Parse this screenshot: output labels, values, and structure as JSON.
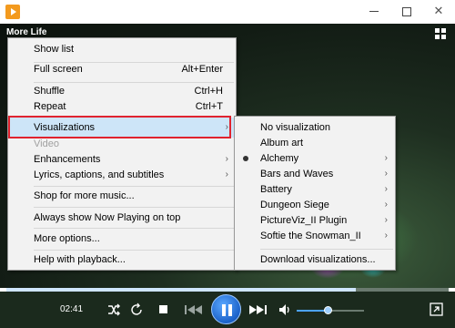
{
  "player": {
    "now_playing_title": "More Life",
    "elapsed_time": "02:41",
    "seek_progress": 0.79,
    "volume_level": 0.46
  },
  "context_menu": {
    "items": [
      {
        "label": "Show list",
        "shortcut": ""
      },
      {
        "label": "Full screen",
        "shortcut": "Alt+Enter"
      },
      {
        "label": "Shuffle",
        "shortcut": "Ctrl+H"
      },
      {
        "label": "Repeat",
        "shortcut": "Ctrl+T"
      },
      {
        "label": "Visualizations",
        "shortcut": ""
      },
      {
        "label": "Video",
        "shortcut": ""
      },
      {
        "label": "Enhancements",
        "shortcut": ""
      },
      {
        "label": "Lyrics, captions, and subtitles",
        "shortcut": ""
      },
      {
        "label": "Shop for more music...",
        "shortcut": ""
      },
      {
        "label": "Always show Now Playing on top",
        "shortcut": ""
      },
      {
        "label": "More options...",
        "shortcut": ""
      },
      {
        "label": "Help with playback...",
        "shortcut": ""
      }
    ]
  },
  "visualizations_menu": {
    "items": [
      {
        "label": "No visualization"
      },
      {
        "label": "Album art"
      },
      {
        "label": "Alchemy"
      },
      {
        "label": "Bars and Waves"
      },
      {
        "label": "Battery"
      },
      {
        "label": "Dungeon Siege"
      },
      {
        "label": "PictureViz_II Plugin"
      },
      {
        "label": "Softie the Snowman_II"
      },
      {
        "label": "Download visualizations..."
      }
    ],
    "selected": "Alchemy"
  },
  "icons": {
    "app": "media-player-icon",
    "shuffle": "shuffle-icon",
    "repeat": "repeat-icon",
    "stop": "stop-icon",
    "previous": "previous-icon",
    "pause": "pause-icon",
    "next": "next-icon",
    "volume": "volume-icon",
    "switch_to_library": "switch-to-library-icon",
    "view_layout": "grid-icon"
  },
  "colors": {
    "menu_highlight": "#cde5f8",
    "annotation_box": "#e0232f",
    "video_background": "#1e2e20",
    "controls_background": "#1b2a1d",
    "play_button": "#1b62c9"
  }
}
